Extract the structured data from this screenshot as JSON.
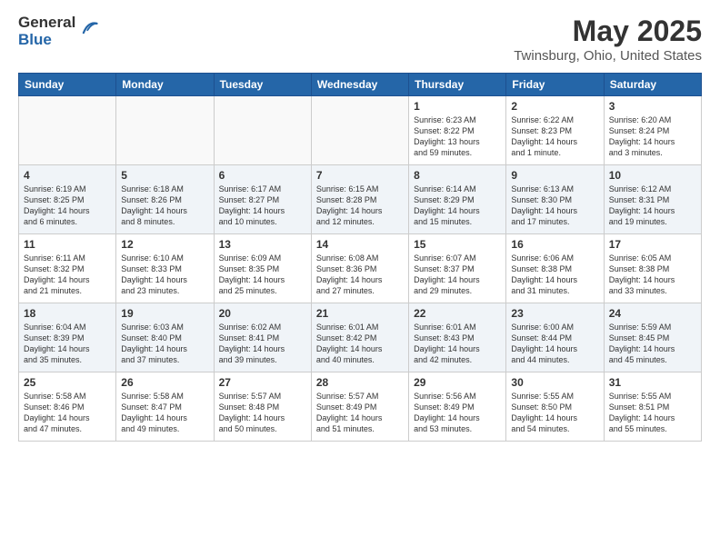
{
  "logo": {
    "general": "General",
    "blue": "Blue"
  },
  "title": "May 2025",
  "subtitle": "Twinsburg, Ohio, United States",
  "days_of_week": [
    "Sunday",
    "Monday",
    "Tuesday",
    "Wednesday",
    "Thursday",
    "Friday",
    "Saturday"
  ],
  "weeks": [
    [
      {
        "day": "",
        "info": ""
      },
      {
        "day": "",
        "info": ""
      },
      {
        "day": "",
        "info": ""
      },
      {
        "day": "",
        "info": ""
      },
      {
        "day": "1",
        "info": "Sunrise: 6:23 AM\nSunset: 8:22 PM\nDaylight: 13 hours\nand 59 minutes."
      },
      {
        "day": "2",
        "info": "Sunrise: 6:22 AM\nSunset: 8:23 PM\nDaylight: 14 hours\nand 1 minute."
      },
      {
        "day": "3",
        "info": "Sunrise: 6:20 AM\nSunset: 8:24 PM\nDaylight: 14 hours\nand 3 minutes."
      }
    ],
    [
      {
        "day": "4",
        "info": "Sunrise: 6:19 AM\nSunset: 8:25 PM\nDaylight: 14 hours\nand 6 minutes."
      },
      {
        "day": "5",
        "info": "Sunrise: 6:18 AM\nSunset: 8:26 PM\nDaylight: 14 hours\nand 8 minutes."
      },
      {
        "day": "6",
        "info": "Sunrise: 6:17 AM\nSunset: 8:27 PM\nDaylight: 14 hours\nand 10 minutes."
      },
      {
        "day": "7",
        "info": "Sunrise: 6:15 AM\nSunset: 8:28 PM\nDaylight: 14 hours\nand 12 minutes."
      },
      {
        "day": "8",
        "info": "Sunrise: 6:14 AM\nSunset: 8:29 PM\nDaylight: 14 hours\nand 15 minutes."
      },
      {
        "day": "9",
        "info": "Sunrise: 6:13 AM\nSunset: 8:30 PM\nDaylight: 14 hours\nand 17 minutes."
      },
      {
        "day": "10",
        "info": "Sunrise: 6:12 AM\nSunset: 8:31 PM\nDaylight: 14 hours\nand 19 minutes."
      }
    ],
    [
      {
        "day": "11",
        "info": "Sunrise: 6:11 AM\nSunset: 8:32 PM\nDaylight: 14 hours\nand 21 minutes."
      },
      {
        "day": "12",
        "info": "Sunrise: 6:10 AM\nSunset: 8:33 PM\nDaylight: 14 hours\nand 23 minutes."
      },
      {
        "day": "13",
        "info": "Sunrise: 6:09 AM\nSunset: 8:35 PM\nDaylight: 14 hours\nand 25 minutes."
      },
      {
        "day": "14",
        "info": "Sunrise: 6:08 AM\nSunset: 8:36 PM\nDaylight: 14 hours\nand 27 minutes."
      },
      {
        "day": "15",
        "info": "Sunrise: 6:07 AM\nSunset: 8:37 PM\nDaylight: 14 hours\nand 29 minutes."
      },
      {
        "day": "16",
        "info": "Sunrise: 6:06 AM\nSunset: 8:38 PM\nDaylight: 14 hours\nand 31 minutes."
      },
      {
        "day": "17",
        "info": "Sunrise: 6:05 AM\nSunset: 8:38 PM\nDaylight: 14 hours\nand 33 minutes."
      }
    ],
    [
      {
        "day": "18",
        "info": "Sunrise: 6:04 AM\nSunset: 8:39 PM\nDaylight: 14 hours\nand 35 minutes."
      },
      {
        "day": "19",
        "info": "Sunrise: 6:03 AM\nSunset: 8:40 PM\nDaylight: 14 hours\nand 37 minutes."
      },
      {
        "day": "20",
        "info": "Sunrise: 6:02 AM\nSunset: 8:41 PM\nDaylight: 14 hours\nand 39 minutes."
      },
      {
        "day": "21",
        "info": "Sunrise: 6:01 AM\nSunset: 8:42 PM\nDaylight: 14 hours\nand 40 minutes."
      },
      {
        "day": "22",
        "info": "Sunrise: 6:01 AM\nSunset: 8:43 PM\nDaylight: 14 hours\nand 42 minutes."
      },
      {
        "day": "23",
        "info": "Sunrise: 6:00 AM\nSunset: 8:44 PM\nDaylight: 14 hours\nand 44 minutes."
      },
      {
        "day": "24",
        "info": "Sunrise: 5:59 AM\nSunset: 8:45 PM\nDaylight: 14 hours\nand 45 minutes."
      }
    ],
    [
      {
        "day": "25",
        "info": "Sunrise: 5:58 AM\nSunset: 8:46 PM\nDaylight: 14 hours\nand 47 minutes."
      },
      {
        "day": "26",
        "info": "Sunrise: 5:58 AM\nSunset: 8:47 PM\nDaylight: 14 hours\nand 49 minutes."
      },
      {
        "day": "27",
        "info": "Sunrise: 5:57 AM\nSunset: 8:48 PM\nDaylight: 14 hours\nand 50 minutes."
      },
      {
        "day": "28",
        "info": "Sunrise: 5:57 AM\nSunset: 8:49 PM\nDaylight: 14 hours\nand 51 minutes."
      },
      {
        "day": "29",
        "info": "Sunrise: 5:56 AM\nSunset: 8:49 PM\nDaylight: 14 hours\nand 53 minutes."
      },
      {
        "day": "30",
        "info": "Sunrise: 5:55 AM\nSunset: 8:50 PM\nDaylight: 14 hours\nand 54 minutes."
      },
      {
        "day": "31",
        "info": "Sunrise: 5:55 AM\nSunset: 8:51 PM\nDaylight: 14 hours\nand 55 minutes."
      }
    ]
  ]
}
